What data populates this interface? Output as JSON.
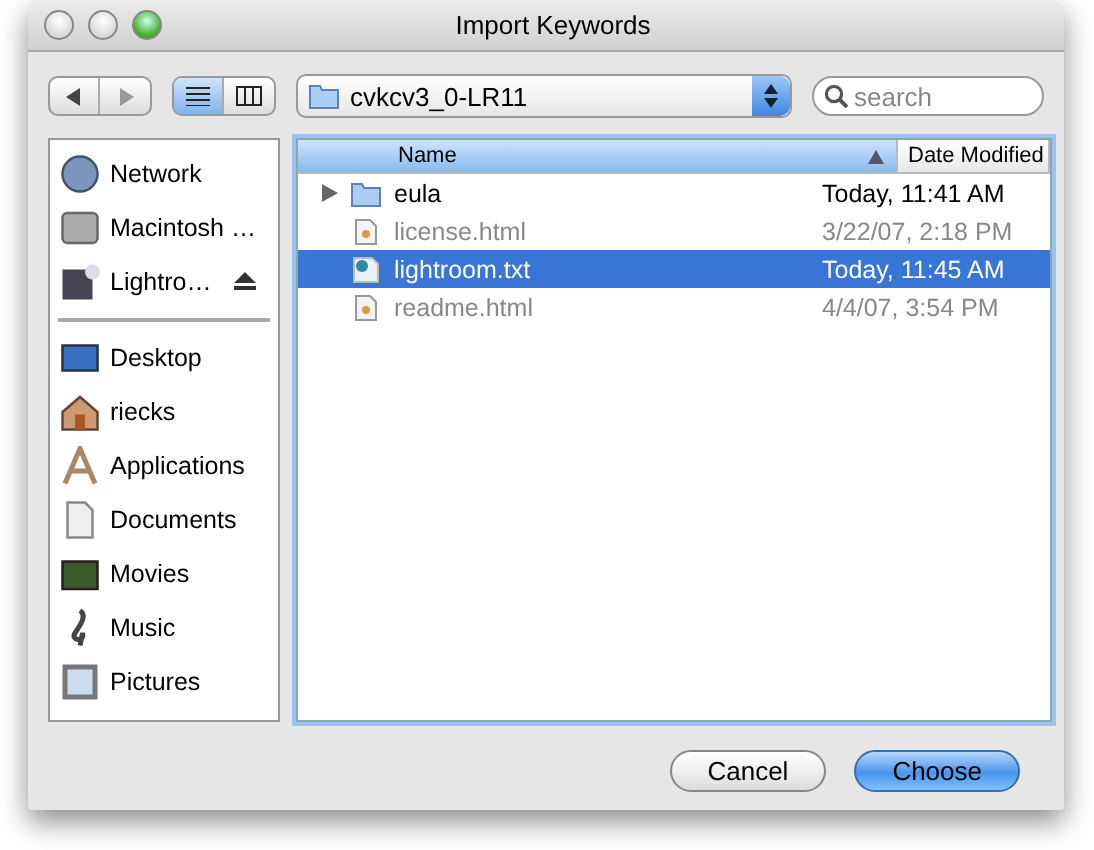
{
  "window": {
    "title": "Import Keywords"
  },
  "view_modes": [
    {
      "kind": "list",
      "selected": true
    },
    {
      "kind": "columns",
      "selected": false
    }
  ],
  "location": {
    "folder": "cvkcv3_0-LR11"
  },
  "search": {
    "placeholder": "search"
  },
  "sidebar": {
    "sections": [
      {
        "items": [
          {
            "kind": "network",
            "label": "Network",
            "eject": false
          },
          {
            "kind": "disk",
            "label": "Macintosh …",
            "eject": false
          },
          {
            "kind": "lightroom",
            "label": "Lightro…",
            "eject": true
          }
        ]
      },
      {
        "items": [
          {
            "kind": "desktop",
            "label": "Desktop",
            "eject": false
          },
          {
            "kind": "home",
            "label": "riecks",
            "eject": false
          },
          {
            "kind": "apps",
            "label": "Applications",
            "eject": false
          },
          {
            "kind": "doc",
            "label": "Documents",
            "eject": false
          },
          {
            "kind": "movies",
            "label": "Movies",
            "eject": false
          },
          {
            "kind": "music",
            "label": "Music",
            "eject": false
          },
          {
            "kind": "pictures",
            "label": "Pictures",
            "eject": false
          }
        ]
      }
    ]
  },
  "table": {
    "columns": [
      {
        "label": "Name",
        "sorted": true
      },
      {
        "label": "Date Modified",
        "sorted": false
      }
    ],
    "rows": [
      {
        "kind": "folder",
        "name": "eula",
        "date": "Today, 11:41 AM",
        "expandable": true,
        "disabled": false,
        "selected": false
      },
      {
        "kind": "html",
        "name": "license.html",
        "date": "3/22/07, 2:18 PM",
        "expandable": false,
        "disabled": true,
        "selected": false
      },
      {
        "kind": "text",
        "name": "lightroom.txt",
        "date": "Today, 11:45 AM",
        "expandable": false,
        "disabled": false,
        "selected": true
      },
      {
        "kind": "html",
        "name": "readme.html",
        "date": "4/4/07, 3:54 PM",
        "expandable": false,
        "disabled": true,
        "selected": false
      }
    ]
  },
  "buttons": [
    {
      "label": "Cancel",
      "default": false
    },
    {
      "label": "Choose",
      "default": true
    }
  ]
}
